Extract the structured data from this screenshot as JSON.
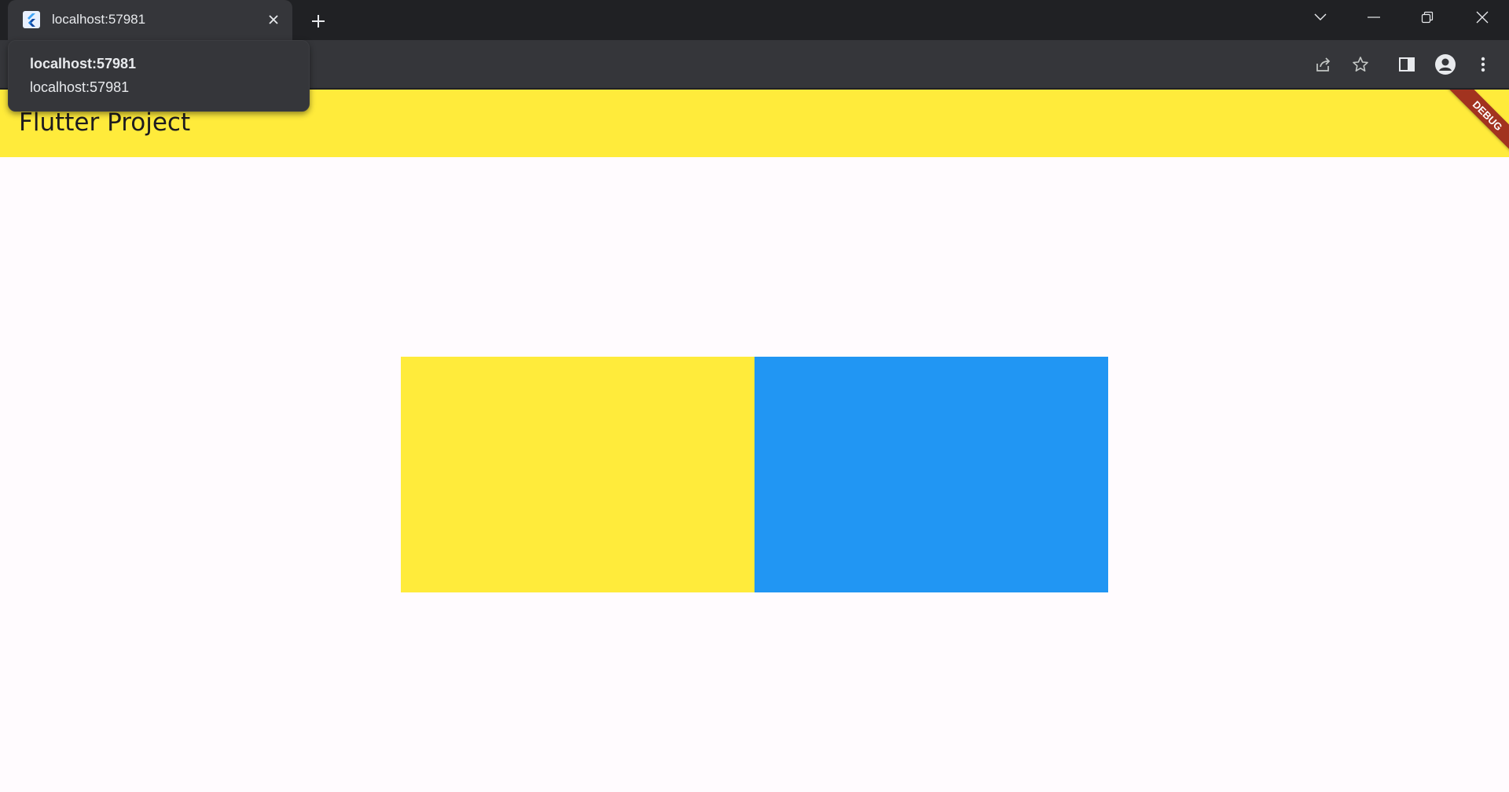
{
  "browser": {
    "tab": {
      "title": "localhost:57981",
      "favicon": "flutter-icon",
      "close": "close-icon"
    },
    "new_tab": "plus-icon",
    "window_controls": [
      "chevron-down-icon",
      "minimize-icon",
      "restore-icon",
      "close-icon"
    ],
    "toolbar_icons": [
      "share-icon",
      "star-icon",
      "side-panel-icon",
      "profile-icon",
      "more-vert-icon"
    ],
    "hover_card": {
      "title": "localhost:57981",
      "url": "localhost:57981"
    }
  },
  "app": {
    "title": "Flutter Project",
    "debug_banner": "DEBUG",
    "colors": {
      "appbar": "#ffeb3b",
      "box_left": "#ffeb3b",
      "box_right": "#2196f3",
      "background": "#fffbfe",
      "debug_banner": "#a2331f"
    }
  }
}
